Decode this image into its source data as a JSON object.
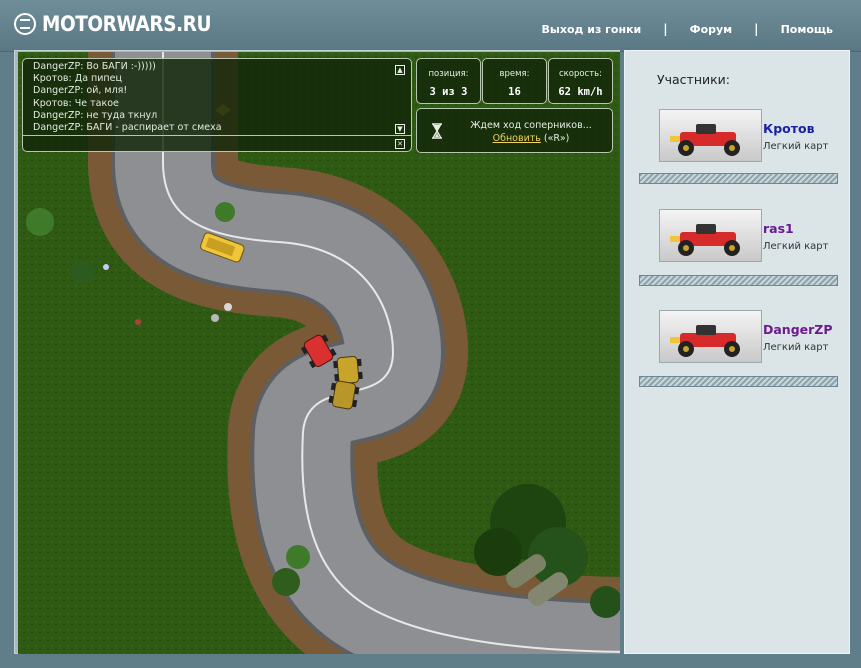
{
  "site": {
    "logo_text": "MOTORWARS.RU"
  },
  "nav": {
    "items": [
      "Выход из гонки",
      "Форум",
      "Помощь"
    ],
    "separator": "|"
  },
  "chat": {
    "lines": [
      {
        "author": "DangerZP",
        "text": " Во БАГИ :-)))))"
      },
      {
        "author": "Кротов",
        "text": " Да пипец"
      },
      {
        "author": "DangerZP",
        "text": " ой, мля!"
      },
      {
        "author": "Кротов",
        "text": " Че такое"
      },
      {
        "author": "DangerZP",
        "text": " не туда ткнул"
      },
      {
        "author": "DangerZP",
        "text": " БАГИ - распирает от смеха"
      }
    ]
  },
  "stats": {
    "position_label": "позиция:",
    "position_value": "3 из 3",
    "time_label": "время:",
    "time_value": "16",
    "speed_label": "скорость:",
    "speed_value": "62 km/h"
  },
  "status": {
    "message": "Ждем ход соперников...",
    "refresh_label": "Обновить",
    "refresh_hint": " («R»)"
  },
  "sidebar": {
    "title": "Участники:",
    "participants": [
      {
        "name": "Кротов",
        "type": "Легкий карт",
        "color": "#1b1fa3"
      },
      {
        "name": "ras1",
        "type": "Легкий карт",
        "color": "#6c1b8f"
      },
      {
        "name": "DangerZP",
        "type": "Легкий карт",
        "color": "#6c1b8f"
      }
    ]
  },
  "colors": {
    "header": "#5f7e89",
    "grass": "#2f5a14",
    "track": "#8d8f92",
    "dirt": "#7a5a36",
    "panel": "#dbe5e8",
    "link_highlight": "#f2d25a"
  }
}
